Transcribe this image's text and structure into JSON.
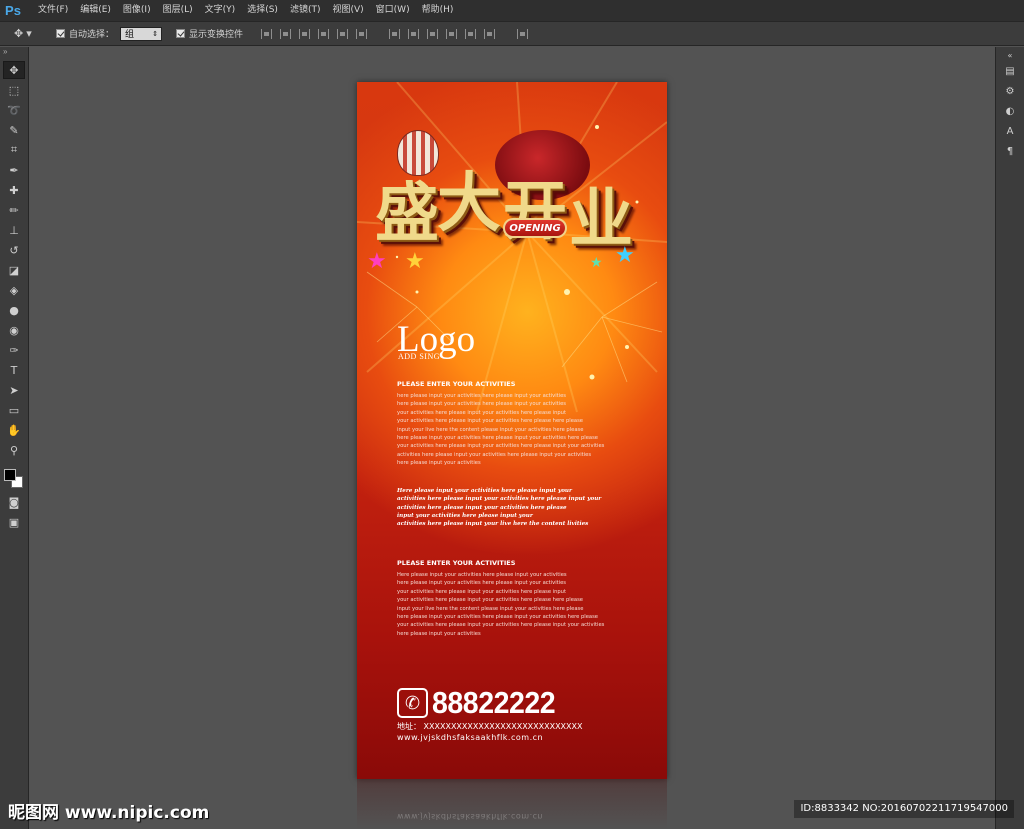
{
  "app": {
    "logo": "Ps"
  },
  "menu": [
    "文件(F)",
    "编辑(E)",
    "图像(I)",
    "图层(L)",
    "文字(Y)",
    "选择(S)",
    "滤镜(T)",
    "视图(V)",
    "窗口(W)",
    "帮助(H)"
  ],
  "options": {
    "auto_select_label": "自动选择：",
    "auto_select_value": "组",
    "show_transform_label": "显示变换控件"
  },
  "poster": {
    "title_chars": [
      "盛",
      "大",
      "开",
      "业"
    ],
    "opening": "OPENING",
    "logo": "Logo",
    "logo_sub": "ADD SING",
    "block1_heading": "PLEASE ENTER YOUR ACTIVITIES",
    "block1_lines": [
      "here please input your activities here please input your activities",
      "here please input your activities here please input your activities",
      "your activities here please input your activities here please input",
      "your activities here please input your activities here please here please",
      "input your live here the content please input your activities here please",
      "here please input your activities here please input your activities here please",
      "your activities here please input your activities here please input your activities",
      " activities here please input your activities here please input your activities",
      "here please input your activities"
    ],
    "script_lines": [
      "Here please input your activities here please input your",
      "activities here please input your activities here please input your",
      "activities here please input your activities here please",
      "input your activities here please input your",
      "activities here please input your live here the content livities"
    ],
    "block2_heading": "PLEASE ENTER YOUR ACTIVITIES",
    "block2_lines": [
      "Here please input your activities here please input your activities",
      "here please input your activities here please input your activities",
      "your activities here please input your activities here please input",
      "your activities here please input your activities here please here please",
      "input your live here the content please input your activities here please",
      "here please input your activities here please input your activities here please",
      "your activities here please input your activities here please input your activities",
      "here please input your activities"
    ],
    "phone": "88822222",
    "address": "地址： XXXXXXXXXXXXXXXXXXXXXXXXXXXXX",
    "website": "www.jvjskdhsfaksaakhflk.com.cn",
    "reflection": "www.jvjskdhsfaksaakhflk.com.cn"
  },
  "watermark": {
    "left": "昵图网 www.nipic.com",
    "right": "ID:8833342 NO:20160702211719547000"
  },
  "colors": {
    "poster_top": "#d8380f",
    "poster_bottom": "#8a0a08",
    "title_gold": "#f0d98a",
    "workspace": "#535353"
  }
}
